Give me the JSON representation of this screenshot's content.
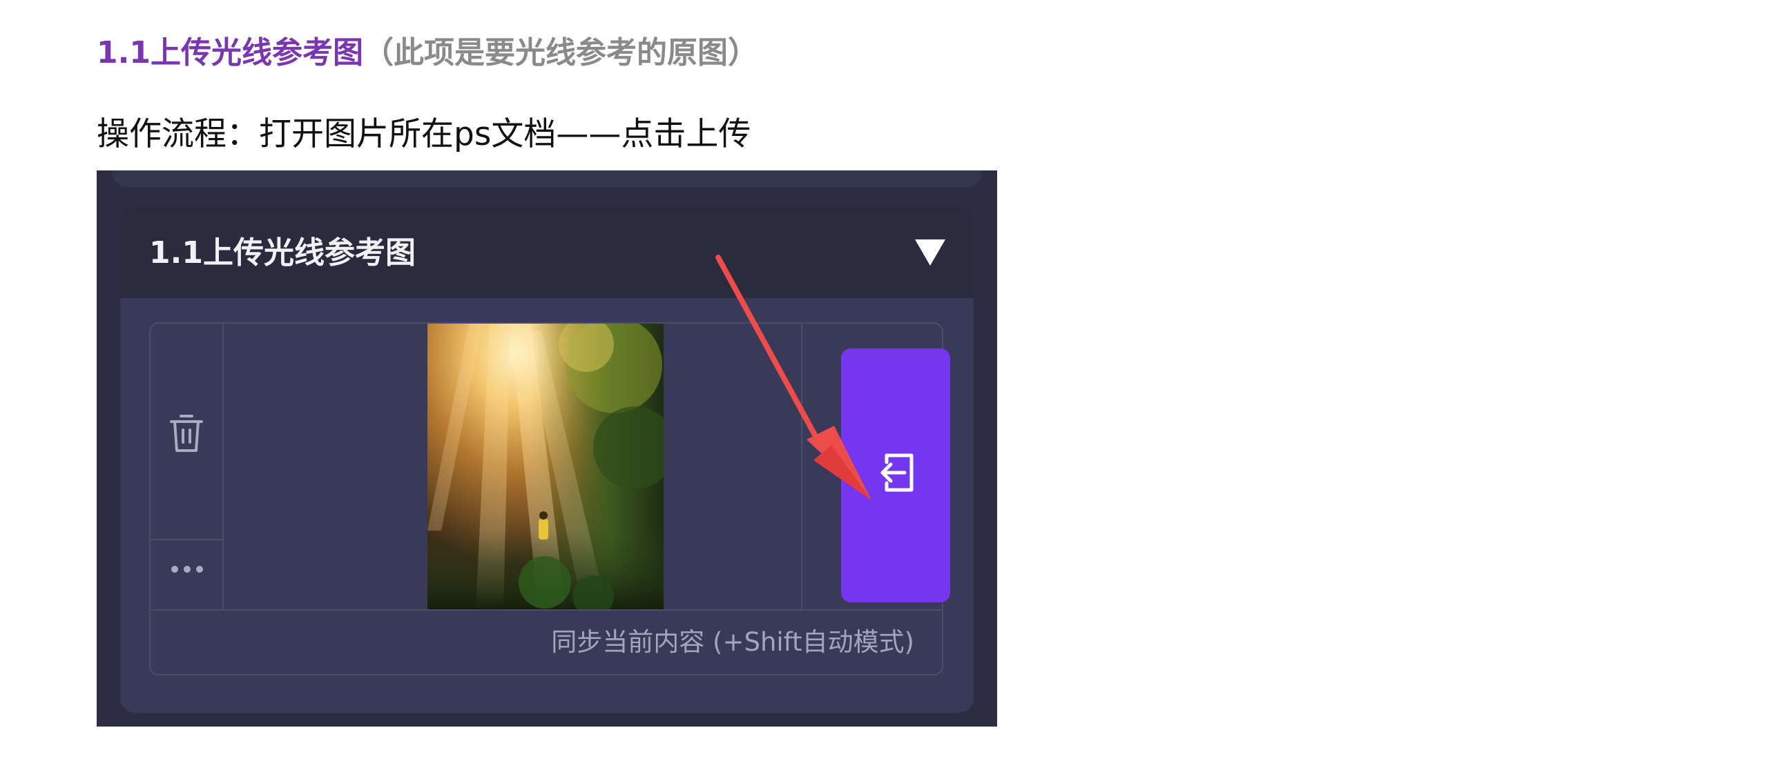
{
  "doc": {
    "heading_main": "1.1上传光线参考图",
    "heading_note": "（此项是要光线参考的原图）",
    "steps": "操作流程：打开图片所在ps文档——点击上传"
  },
  "screenshot": {
    "panel_title": "1.1上传光线参考图",
    "sync_label": "同步当前内容 (+Shift自动模式)",
    "icons": {
      "collapse": "triangle-down-icon",
      "delete": "trash-icon",
      "more": "ellipsis-icon",
      "upload": "upload-sync-icon",
      "annotation": "red-arrow"
    }
  },
  "colors": {
    "heading_main": "#7a36b1",
    "heading_note": "#8a8a8a",
    "panel_background": "#383a57",
    "header_background": "#2a2b3d",
    "upload_button": "#7536f0",
    "annotation_arrow": "#ee4b4b"
  }
}
